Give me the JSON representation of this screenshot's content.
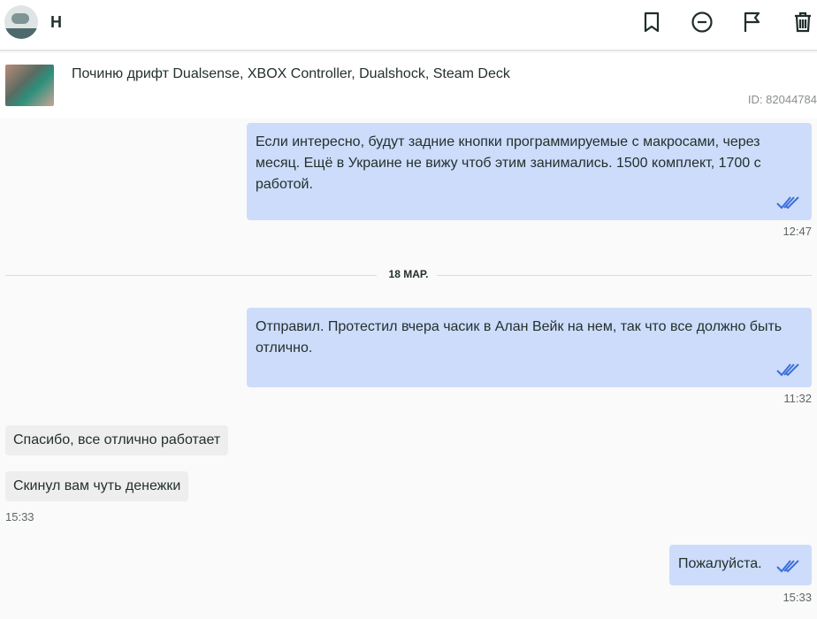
{
  "header": {
    "name": "Н",
    "icons": [
      "bookmark-icon",
      "block-icon",
      "flag-icon",
      "trash-icon"
    ]
  },
  "ad": {
    "title": "Починю дрифт Dualsense, XBOX Controller, Dualshock, Steam Deck",
    "id": "ID: 82044784"
  },
  "messages": [
    {
      "text": "Если интересно, будут задние кнопки программируемые с макросами, через месяц. Ещё в Украине не вижу чтоб этим занимались. 1500 комплект, 1700 с работой.",
      "time": "12:47"
    },
    {
      "text": "Отправил. Протестил вчера часик в Алан Вейк на нем, так что все должно быть отлично.",
      "time": "11:32"
    },
    {
      "text": "Спасибо, все отлично работает"
    },
    {
      "text": "Скинул вам чуть денежки",
      "time": "15:33"
    },
    {
      "text": "Пожалуйста.",
      "time": "15:33"
    }
  ],
  "date_separator": "18 МАР.",
  "colors": {
    "outgoing": "#cddcfa",
    "incoming": "#eeeeee",
    "check": "#3b6fd8"
  }
}
